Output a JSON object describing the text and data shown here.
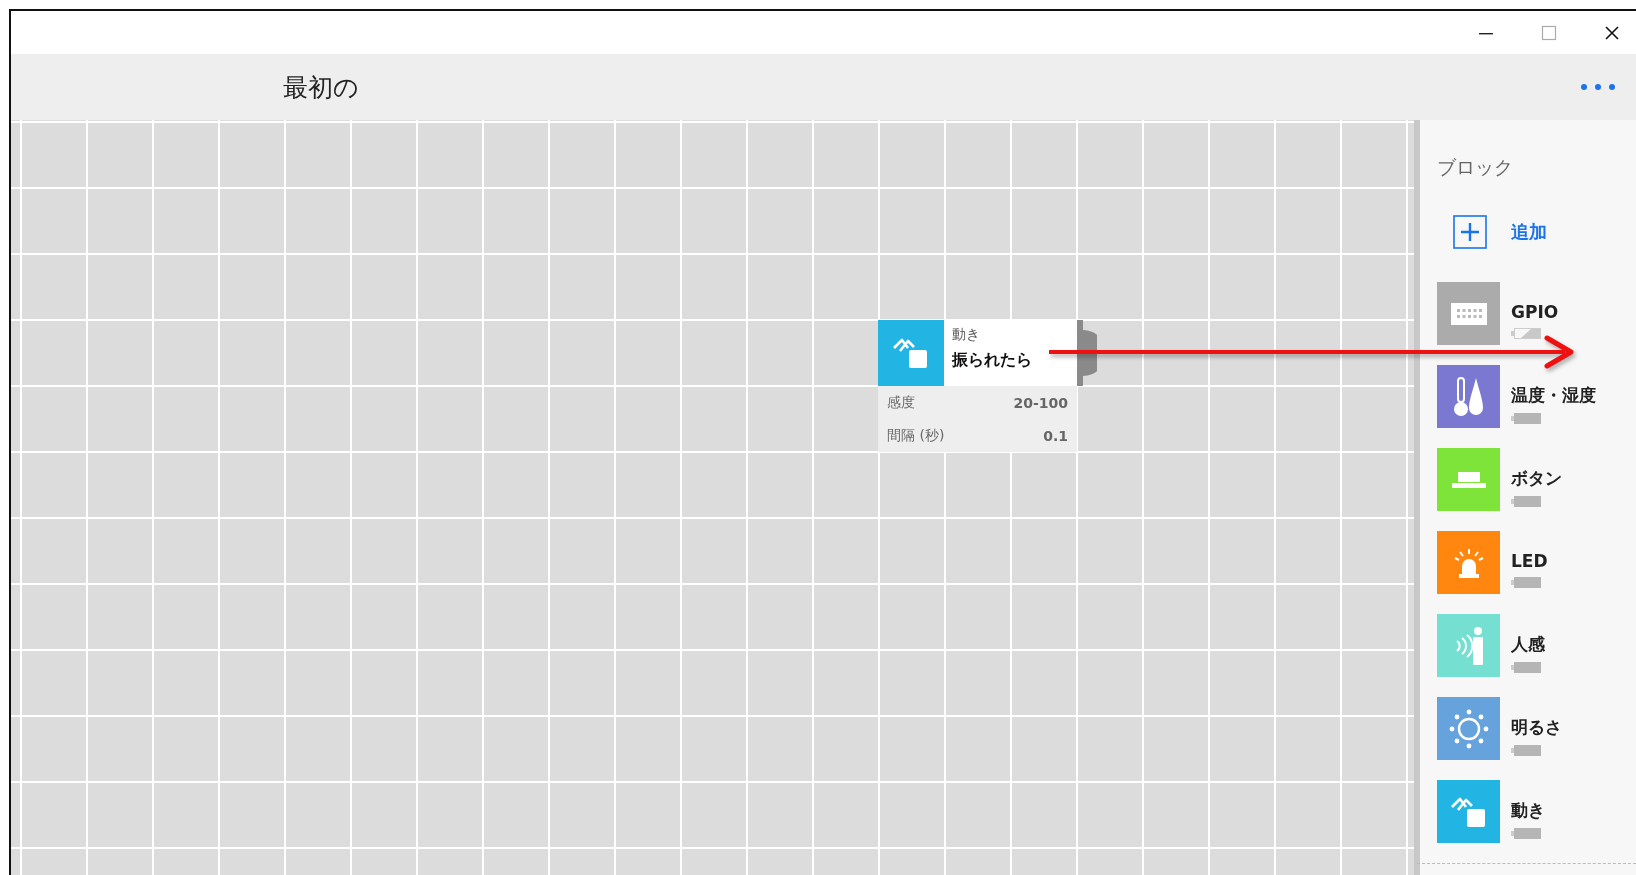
{
  "header": {
    "title": "最初の"
  },
  "canvas": {
    "blocks": [
      {
        "kind": "motion",
        "color": "#22b5e3",
        "category": "動き",
        "title": "振られたら",
        "params": [
          {
            "label": "感度",
            "value": "20-100"
          },
          {
            "label": "間隔 (秒)",
            "value": "0.1"
          }
        ]
      }
    ]
  },
  "sidebar": {
    "heading": "ブロック",
    "add_label": "追加",
    "items": [
      {
        "kind": "gpio",
        "color": "#ababab",
        "label": "GPIO",
        "battery_known": false
      },
      {
        "kind": "temperature",
        "color": "#7a78d0",
        "label": "温度・湿度",
        "battery_known": true
      },
      {
        "kind": "button",
        "color": "#7fe43a",
        "label": "ボタン",
        "battery_known": true
      },
      {
        "kind": "led",
        "color": "#ff870f",
        "label": "LED",
        "battery_known": true
      },
      {
        "kind": "human",
        "color": "#75e0d2",
        "label": "人感",
        "battery_known": true
      },
      {
        "kind": "light",
        "color": "#66a3dd",
        "label": "明るさ",
        "battery_known": true
      },
      {
        "kind": "motion",
        "color": "#22b5e3",
        "label": "動き",
        "battery_known": true
      }
    ]
  }
}
